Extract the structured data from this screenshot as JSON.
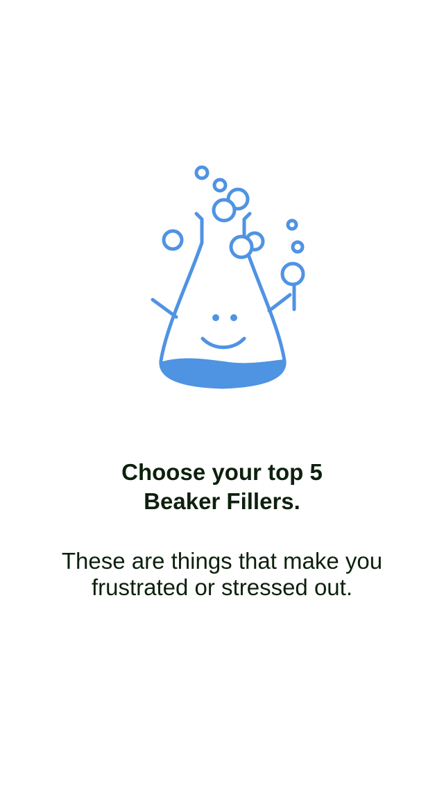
{
  "illustration": {
    "icon": "smiling-beaker-icon",
    "color": "#4f93e3"
  },
  "heading": {
    "line1": "Choose your top 5",
    "line2": "Beaker Fillers."
  },
  "subtext": {
    "line1": "These are things that make you",
    "line2": "frustrated or stressed out."
  },
  "colors": {
    "text": "#0d200d",
    "background": "#ffffff",
    "accent": "#4f93e3"
  }
}
